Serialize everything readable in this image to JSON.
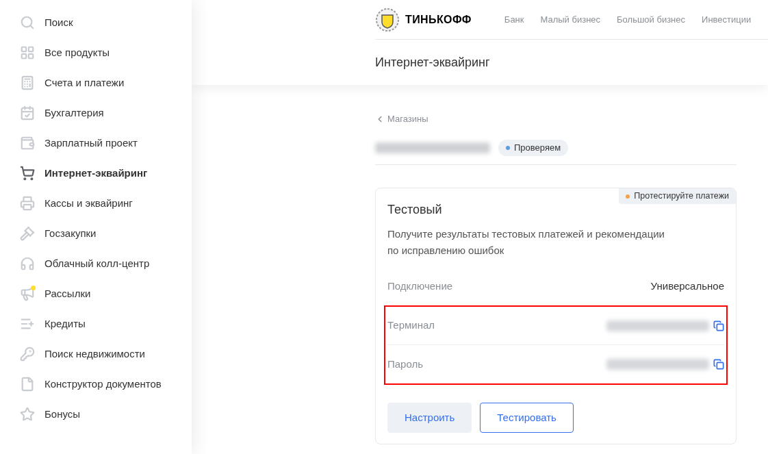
{
  "sidebar": {
    "items": [
      {
        "label": "Поиск",
        "selected": false,
        "notification": false
      },
      {
        "label": "Все продукты",
        "selected": false,
        "notification": false
      },
      {
        "label": "Счета и платежи",
        "selected": false,
        "notification": false
      },
      {
        "label": "Бухгалтерия",
        "selected": false,
        "notification": false
      },
      {
        "label": "Зарплатный проект",
        "selected": false,
        "notification": false
      },
      {
        "label": "Интернет-эквайринг",
        "selected": true,
        "notification": false
      },
      {
        "label": "Кассы и эквайринг",
        "selected": false,
        "notification": false
      },
      {
        "label": "Госзакупки",
        "selected": false,
        "notification": false
      },
      {
        "label": "Облачный колл-центр",
        "selected": false,
        "notification": false
      },
      {
        "label": "Рассылки",
        "selected": false,
        "notification": true
      },
      {
        "label": "Кредиты",
        "selected": false,
        "notification": false
      },
      {
        "label": "Поиск недвижимости",
        "selected": false,
        "notification": false
      },
      {
        "label": "Конструктор документов",
        "selected": false,
        "notification": false
      },
      {
        "label": "Бонусы",
        "selected": false,
        "notification": false
      }
    ]
  },
  "header": {
    "logo": "ТИНЬКОФФ",
    "nav": [
      "Банк",
      "Малый бизнес",
      "Большой бизнес",
      "Инвестиции"
    ]
  },
  "page_title": "Интернет-эквайринг",
  "breadcrumb": "Магазины",
  "shop": {
    "status": {
      "label": "Проверяем",
      "color": "#5b9be0"
    }
  },
  "card": {
    "title": "Тестовый",
    "tag": {
      "label": "Протестируйте платежи",
      "color": "#f5a04a"
    },
    "description": "Получите результаты тестовых платежей и рекомендации по исправлению ошибок",
    "rows": [
      {
        "kind": "text",
        "label": "Подключение",
        "value": "Универсальное"
      },
      {
        "kind": "secret",
        "label": "Терминал"
      },
      {
        "kind": "secret",
        "label": "Пароль"
      }
    ],
    "buttons": [
      {
        "label": "Настроить",
        "kind": "secondary"
      },
      {
        "label": "Тестировать",
        "kind": "outline"
      }
    ]
  }
}
